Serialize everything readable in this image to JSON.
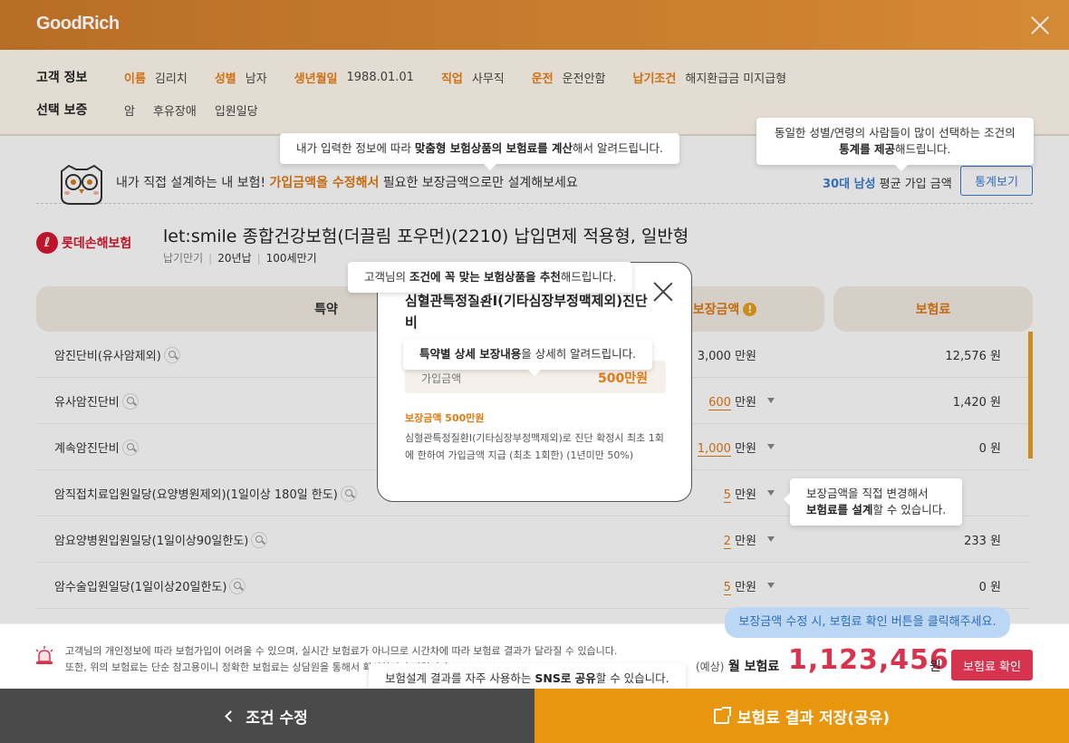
{
  "header": {
    "logo": "GoodRich"
  },
  "customer": {
    "head": "고객 정보",
    "fields": [
      {
        "k": "이름",
        "v": "김리치"
      },
      {
        "k": "성별",
        "v": "남자"
      },
      {
        "k": "생년월일",
        "v": "1988.01.01"
      },
      {
        "k": "직업",
        "v": "사무직"
      },
      {
        "k": "운전",
        "v": "운전안함"
      },
      {
        "k": "납기조건",
        "v": "해지환급금 미지급형"
      }
    ]
  },
  "coverage": {
    "head": "선택 보증",
    "items": [
      "암",
      "후유장애",
      "입원일당"
    ]
  },
  "banner": {
    "text_pre": "내가 직접 설계하는 내 보험!",
    "text_hl": "가입금액을 수정해서",
    "text_post": "필요한 보장금액으로만 설계해보세요",
    "stat_hl": "30대 남성",
    "stat_post": "평균 가입 금액",
    "stat_button": "통계보기"
  },
  "product": {
    "brand": "롯데손해보험",
    "brand_mark": "ℓ",
    "title": "let:smile 종합건강보험(더끌림 포우먼)(2210) 납입면제 적용형, 일반형",
    "meta": [
      "납기만기",
      "20년납",
      "100세만기"
    ]
  },
  "table": {
    "col_special": "특약",
    "col_coverage": "보장금액",
    "col_premium": "보험료",
    "rows": [
      {
        "name": "암진단비(유사암제외)",
        "amount": "3,000",
        "unit": "만원",
        "editable": false,
        "premium": "12,576 원"
      },
      {
        "name": "유사암진단비",
        "amount": "600",
        "unit": "만원",
        "editable": true,
        "premium": "1,420 원"
      },
      {
        "name": "계속암진단비",
        "amount": "1,000",
        "unit": "만원",
        "editable": true,
        "premium": "0 원"
      },
      {
        "name": "암직접치료입원일당(요양병원제외)(1일이상 180일 한도)",
        "amount": "5",
        "unit": "만원",
        "editable": true,
        "premium": ""
      },
      {
        "name": "암요양병원입원일당(1일이상90일한도)",
        "amount": "2",
        "unit": "만원",
        "editable": true,
        "premium": "233 원"
      },
      {
        "name": "암수술입원일당(1일이상20일한도)",
        "amount": "5",
        "unit": "만원",
        "editable": true,
        "premium": "0 원"
      }
    ]
  },
  "popup": {
    "title": "심혈관특정질환Ⅰ(기타심장부정맥제외)진단비",
    "amount_label": "가입금액",
    "amount_value": "500만원",
    "sub_title": "보장금액 500만원",
    "desc": "심혈관특정질환Ⅰ(기타심장부정맥제외)로 진단 확정시 최초 1회에 한하여 가입금액 지급 (최초 1회한) (1년미만 50%)"
  },
  "tips": {
    "t1_pre": "내가 입력한 정보에 따라 ",
    "t1_b1": "맞춤형 보험상품의 보험료를 계산",
    "t1_post": "해서 알려드립니다.",
    "t2_line1": "동일한 성별/연령의 사람들이 많이 선택하는 조건의",
    "t2_b": "통계를 제공",
    "t2_post": "해드립니다.",
    "t3_pre": "고객님의 ",
    "t3_b1": "조건에 꼭 맞는 보험상품을 추천",
    "t3_post": "해드립니다.",
    "t4_b": "특약별 상세 보장내용",
    "t4_post": "을 상세히 알려드립니다.",
    "t5_line1": "보장금액을 직접 변경해서",
    "t5_b": "보험료를 설계",
    "t5_post": "할 수 있습니다.",
    "t6_pre": "보험설계 결과를 자주 사용하는 ",
    "t6_b": "SNS로 공유",
    "t6_post": "할 수 있습니다."
  },
  "bottom": {
    "notice1": "고객님의 개인정보에 따라 보험가입이 어려울 수 있으며, 실시간 보험료가 아니므로 시간차에 따라 보험료 결과가 달라질 수 있습니다.",
    "notice2": "또한, 위의 보험료는 단순 참고용이니 정확한 보험료는 상담원을 통해서 확인하시기 바랍니다.",
    "hint": "보장금액 수정 시, 보험료 확인 버튼을 클릭해주세요.",
    "total_pre": "(예상)",
    "total_label": "월 보험료",
    "total_amount": "1,123,456",
    "total_unit": "원",
    "confirm": "보험료 확인"
  },
  "footer": {
    "left": "조건 수정",
    "right": "보험료 결과 저장(공유)"
  },
  "colors": {
    "accent": "#e07a15",
    "brand_red": "#d6192f",
    "price_red": "#d6334e",
    "blue": "#3a7bd5",
    "footer_dark": "#4a4a4a",
    "footer_orange": "#e8960e"
  }
}
